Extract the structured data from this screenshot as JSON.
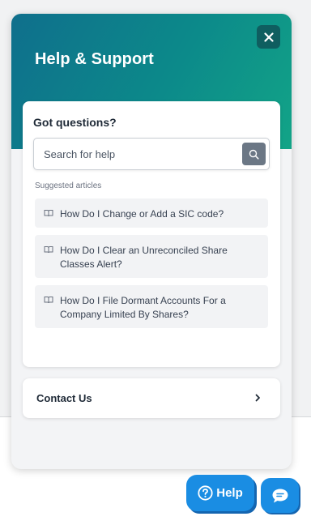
{
  "panel": {
    "title": "Help & Support",
    "close_icon": "close-icon"
  },
  "questions": {
    "heading": "Got questions?",
    "search": {
      "placeholder": "Search for help",
      "value": "",
      "icon": "search-icon"
    },
    "suggested_label": "Suggested articles",
    "articles": [
      {
        "icon": "book-icon",
        "title": "How Do I Change or Add a SIC code?"
      },
      {
        "icon": "book-icon",
        "title": "How Do I Clear an Unreconciled Share Classes Alert?"
      },
      {
        "icon": "book-icon",
        "title": "How Do I File Dormant Accounts For a Company Limited By Shares?"
      }
    ]
  },
  "contact": {
    "label": "Contact Us",
    "icon": "chevron-right-icon"
  },
  "launcher": {
    "help_label": "Help",
    "help_icon": "question-circle-icon",
    "chat_icon": "chat-bubble-icon"
  },
  "colors": {
    "header_gradient_start": "#0f6f8c",
    "header_gradient_end": "#12a487",
    "close_button": "#0f5e60",
    "launcher_blue": "#1a8de3",
    "search_button": "#6b7785"
  }
}
